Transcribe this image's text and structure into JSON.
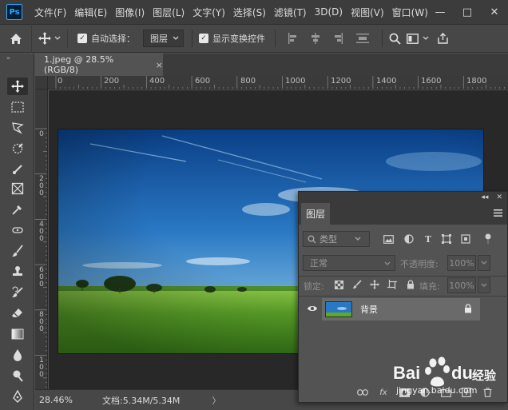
{
  "app": {
    "logo": "Ps",
    "menu": [
      "文件(F)",
      "编辑(E)",
      "图像(I)",
      "图层(L)",
      "文字(Y)",
      "选择(S)",
      "滤镜(T)",
      "3D(D)",
      "视图(V)",
      "窗口(W)"
    ],
    "window_controls": [
      "—",
      "□",
      "✕"
    ]
  },
  "options": {
    "auto_select_label": "自动选择：",
    "auto_select_checked": true,
    "auto_select_target": "图层",
    "show_transform_label": "显示变换控件",
    "show_transform_checked": true
  },
  "document": {
    "tab_label": "1.jpeg @ 28.5%(RGB/8)",
    "close_glyph": "×"
  },
  "ruler": {
    "top_labels": [
      "0",
      "200",
      "400",
      "600",
      "800",
      "1000",
      "1200",
      "1400",
      "1600",
      "1800"
    ],
    "left_labels": [
      "0",
      "2\n0\n0",
      "4\n0\n0",
      "6\n0\n0",
      "8\n0\n0",
      "1\n0\n0"
    ]
  },
  "status": {
    "zoom": "28.46%",
    "doc_info": "文档:5.34M/5.34M",
    "arrow": "〉"
  },
  "layers_panel": {
    "collapse_glyph": "◂◂",
    "close_glyph": "✕",
    "tab_label": "图层",
    "filter_kind": "类型",
    "blend_mode": "正常",
    "opacity_label": "不透明度:",
    "opacity_value": "100%",
    "lock_label": "锁定:",
    "fill_label": "填充:",
    "fill_value": "100%",
    "layers": [
      {
        "name": "背景",
        "visible": true,
        "locked": true
      }
    ],
    "footer_fx": "fx"
  },
  "watermark": {
    "brand": "Bai",
    "brand2": "du",
    "suffix": "经验",
    "domain": "jingyan.baidu.com"
  },
  "colors": {
    "accent": "#31a8ff",
    "sky_top": "#0a3f86",
    "sky_bottom": "#7ab6de",
    "grass": "#5ea82a"
  }
}
